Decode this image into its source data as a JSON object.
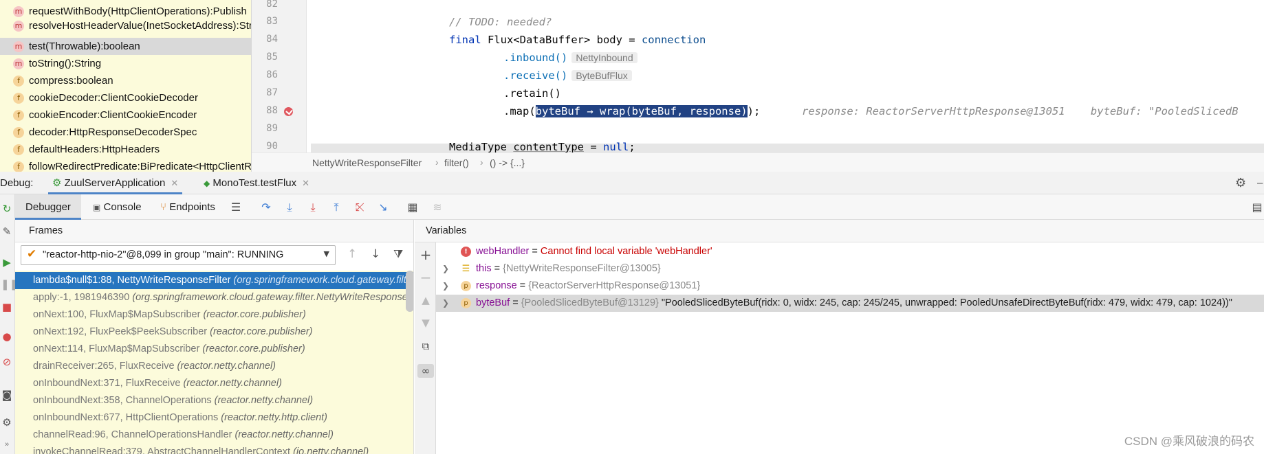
{
  "structure": {
    "items": [
      {
        "icon": "m",
        "label": "requestWithBody(HttpClientOperations):Publish"
      },
      {
        "icon": "m",
        "label": "resolveHostHeaderValue(InetSocketAddress):Stri"
      },
      {
        "icon": "m",
        "label": "test(Throwable):boolean"
      },
      {
        "icon": "m",
        "label": "toString():String"
      },
      {
        "icon": "f",
        "label": "compress:boolean"
      },
      {
        "icon": "f",
        "label": "cookieDecoder:ClientCookieDecoder"
      },
      {
        "icon": "f",
        "label": "cookieEncoder:ClientCookieEncoder"
      },
      {
        "icon": "f",
        "label": "decoder:HttpResponseDecoderSpec"
      },
      {
        "icon": "f",
        "label": "defaultHeaders:HttpHeaders"
      },
      {
        "icon": "f",
        "label": "followRedirectPredicate:BiPredicate<HttpClientR"
      }
    ]
  },
  "editor": {
    "lines": [
      "82",
      "83",
      "84",
      "85",
      "86",
      "87",
      "88",
      "89",
      "90"
    ],
    "comment": "// TODO: needed?",
    "kw_final": "final",
    "decl": " Flux<DataBuffer> body = ",
    "connection": "connection",
    "inbound": ".inbound()",
    "inbound_hint": "NettyInbound",
    "receive": ".receive()",
    "receive_hint": "ByteBufFlux",
    "retain": ".retain()",
    "map_open": ".map(",
    "map_sel": "byteBuf → wrap(byteBuf, response)",
    "map_close": ");",
    "inline_values": "response: ReactorServerHttpResponse@13051    byteBuf: \"PooledSlicedB",
    "line90_type": "MediaType ",
    "line90_var": "contentType",
    "line90_eq": " = ",
    "line90_null": "null",
    "line90_end": ";"
  },
  "breadcrumb": [
    "NettyWriteResponseFilter",
    "filter()",
    "() -> {...}"
  ],
  "debug_tabs": {
    "label": "Debug:",
    "tabs": [
      "ZuulServerApplication",
      "MonoTest.testFlux"
    ]
  },
  "toolbar": {
    "tabs": [
      "Debugger",
      "Console",
      "Endpoints"
    ]
  },
  "frames": {
    "header": "Frames",
    "thread": "\"reactor-http-nio-2\"@8,099 in group \"main\": RUNNING",
    "items": [
      {
        "method": "lambda$null$1:88, NettyWriteResponseFilter",
        "pkg": "(org.springframework.cloud.gateway.filter.NettyWriteResponseFilter)"
      },
      {
        "method": "apply:-1, 1981946390",
        "pkg": "(org.springframework.cloud.gateway.filter.NettyWriteResponseFilter$$Lambda)"
      },
      {
        "method": "onNext:100, FluxMap$MapSubscriber",
        "pkg": "(reactor.core.publisher)"
      },
      {
        "method": "onNext:192, FluxPeek$PeekSubscriber",
        "pkg": "(reactor.core.publisher)"
      },
      {
        "method": "onNext:114, FluxMap$MapSubscriber",
        "pkg": "(reactor.core.publisher)"
      },
      {
        "method": "drainReceiver:265, FluxReceive",
        "pkg": "(reactor.netty.channel)"
      },
      {
        "method": "onInboundNext:371, FluxReceive",
        "pkg": "(reactor.netty.channel)"
      },
      {
        "method": "onInboundNext:358, ChannelOperations",
        "pkg": "(reactor.netty.channel)"
      },
      {
        "method": "onInboundNext:677, HttpClientOperations",
        "pkg": "(reactor.netty.http.client)"
      },
      {
        "method": "channelRead:96, ChannelOperationsHandler",
        "pkg": "(reactor.netty.channel)"
      },
      {
        "method": "invokeChannelRead:379, AbstractChannelHandlerContext",
        "pkg": "(io.netty.channel)"
      }
    ]
  },
  "variables": {
    "header": "Variables",
    "items": [
      {
        "name": "webHandler",
        "eq": " = ",
        "ref": "",
        "value": "Cannot find local variable 'webHandler'"
      },
      {
        "name": "this",
        "eq": " = ",
        "ref": "{NettyWriteResponseFilter@13005}",
        "value": ""
      },
      {
        "name": "response",
        "eq": " = ",
        "ref": "{ReactorServerHttpResponse@13051}",
        "value": ""
      },
      {
        "name": "byteBuf",
        "eq": " = ",
        "ref": "{PooledSlicedByteBuf@13129}",
        "value": " \"PooledSlicedByteBuf(ridx: 0, widx: 245, cap: 245/245, unwrapped: PooledUnsafeDirectByteBuf(ridx: 479, widx: 479, cap: 1024))\""
      }
    ]
  },
  "watermark": "CSDN @乘风破浪的码农"
}
